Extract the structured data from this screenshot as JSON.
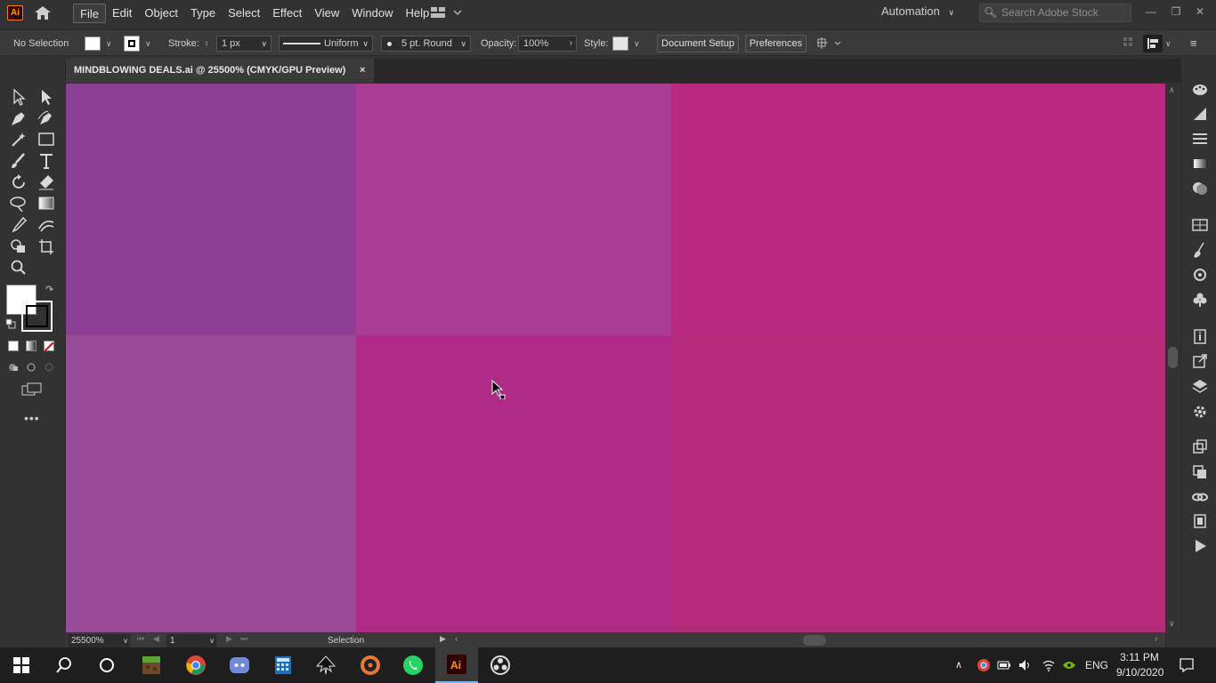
{
  "app": {
    "logo_text": "Ai",
    "brand_color": "#ff9a00"
  },
  "menu": {
    "items": [
      {
        "label": "File"
      },
      {
        "label": "Edit"
      },
      {
        "label": "Object"
      },
      {
        "label": "Type"
      },
      {
        "label": "Select"
      },
      {
        "label": "Effect"
      },
      {
        "label": "View"
      },
      {
        "label": "Window"
      },
      {
        "label": "Help"
      }
    ],
    "workspace": "Automation",
    "search_placeholder": "Search Adobe Stock"
  },
  "control_bar": {
    "selection_label": "No Selection",
    "stroke_label": "Stroke:",
    "stroke_weight": "1 px",
    "stroke_profile": "Uniform",
    "brush": "5 pt. Round",
    "opacity_label": "Opacity:",
    "opacity_value": "100%",
    "style_label": "Style:",
    "document_setup": "Document Setup",
    "preferences": "Preferences"
  },
  "document": {
    "tab_title": "MINDBLOWING DEALS.ai @ 25500% (CMYK/GPU Preview)",
    "close_glyph": "×"
  },
  "canvas": {
    "colors": {
      "top_left": "#8c3f94",
      "top_mid": "#a83d93",
      "top_right": "#b7287f",
      "bottom_left": "#9a4b97",
      "bottom_mid": "#b02b88",
      "bottom_right": "#b52a79"
    }
  },
  "status_bar": {
    "zoom": "25500%",
    "artboard": "1",
    "tool": "Selection"
  },
  "taskbar": {
    "apps": [
      "start",
      "search",
      "cortana",
      "minecraft",
      "chrome",
      "discord",
      "calculator",
      "inkscape",
      "media-player",
      "whatsapp",
      "illustrator",
      "obs"
    ],
    "language": "ENG",
    "time": "3:11 PM",
    "date": "9/10/2020"
  }
}
